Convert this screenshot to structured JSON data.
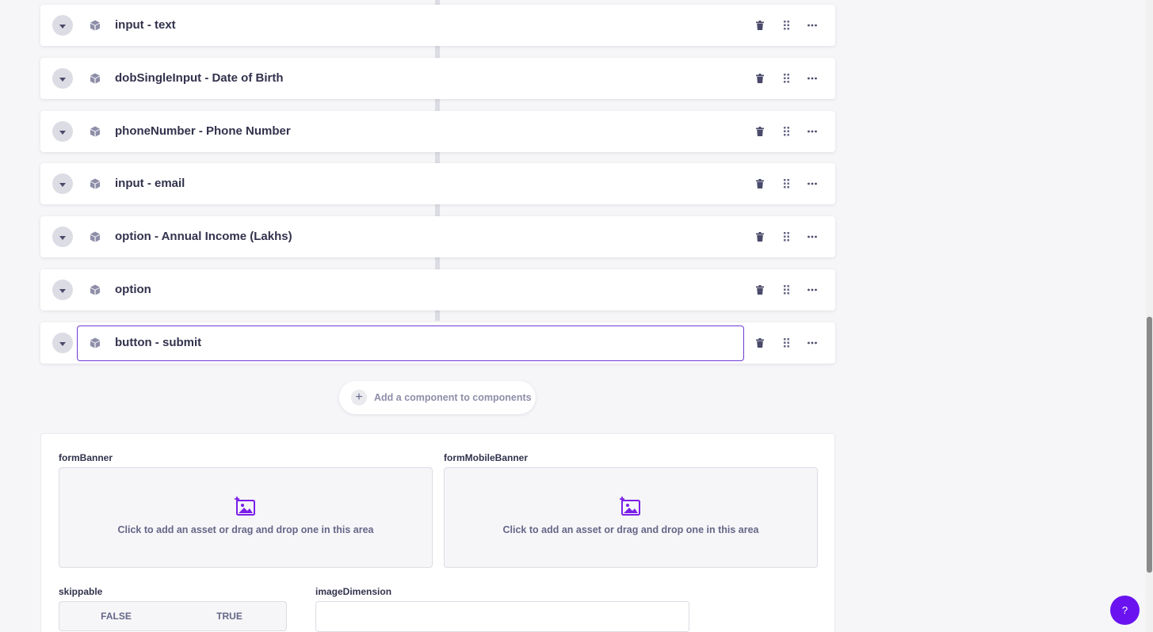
{
  "components": [
    {
      "label": "input - text",
      "active": false
    },
    {
      "label": "dobSingleInput - Date of Birth",
      "active": false
    },
    {
      "label": "phoneNumber - Phone Number",
      "active": false
    },
    {
      "label": "input - email",
      "active": false
    },
    {
      "label": "option - Annual Income (Lakhs)",
      "active": false
    },
    {
      "label": "option",
      "active": false
    },
    {
      "label": "button - submit",
      "active": true
    }
  ],
  "add_component": {
    "label": "Add a component to components",
    "icon": "plus-icon"
  },
  "fields": {
    "form_banner": {
      "label": "formBanner",
      "dropzone_text": "Click to add an asset or drag and drop one in this area",
      "icon": "add-image-icon"
    },
    "form_mobile_banner": {
      "label": "formMobileBanner",
      "dropzone_text": "Click to add an asset or drag and drop one in this area",
      "icon": "add-image-icon"
    },
    "skippable": {
      "label": "skippable",
      "false_label": "FALSE",
      "true_label": "TRUE"
    },
    "image_dimension": {
      "label": "imageDimension",
      "value": ""
    }
  },
  "help_button": {
    "label": "?"
  },
  "colors": {
    "accent": "#7b1fe8",
    "active_border": "#6d3bd6",
    "icon": "#4a4a6a",
    "muted_text": "#666687"
  }
}
